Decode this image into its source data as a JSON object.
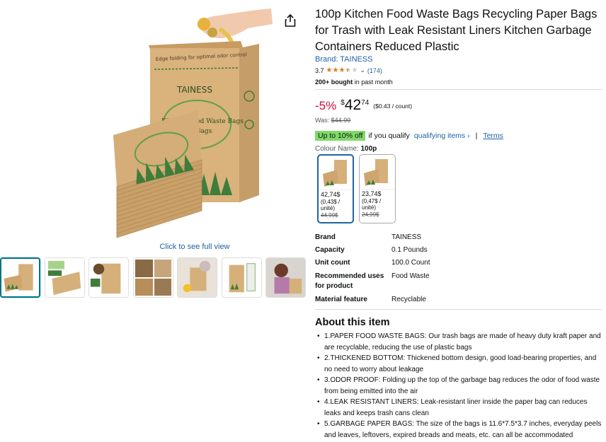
{
  "product": {
    "title": "100p Kitchen Food Waste Bags Recycling Paper Bags for Trash with Leak Resistant Liners Kitchen Garbage Containers Reduced Plastic",
    "brand_link": "Brand: TAINESS",
    "rating_value": "3.7",
    "rating_fraction": 0.74,
    "review_count": "(174)",
    "bought_bold": "200+ bought",
    "bought_rest": " in past month"
  },
  "gallery": {
    "see_full": "Click to see full view",
    "share_icon": "share-icon",
    "thumbnails": [
      {
        "name": "thumb-1",
        "selected": true
      },
      {
        "name": "thumb-2",
        "selected": false
      },
      {
        "name": "thumb-3",
        "selected": false
      },
      {
        "name": "thumb-4",
        "selected": false
      },
      {
        "name": "thumb-5",
        "selected": false
      },
      {
        "name": "thumb-6",
        "selected": false
      },
      {
        "name": "thumb-7",
        "selected": false
      }
    ],
    "box_text": {
      "brand": "TAINESS",
      "line1": "Kitchen Food Waste Bags",
      "line2": "Trash Bags",
      "fold": "Edge folding for optimal odor control"
    }
  },
  "price": {
    "discount": "-5%",
    "currency": "$",
    "whole": "42",
    "fraction": "74",
    "unit_price": "($0.43 / count)",
    "was_label": "Was: ",
    "was_price": "$44.99"
  },
  "promo": {
    "badge": "Up to 10% off",
    "text": " if you qualify",
    "link": "qualifying items ›",
    "sep": "|",
    "terms": "Terms"
  },
  "colour": {
    "label": "Colour Name: ",
    "value": "100p",
    "options": [
      {
        "price": "42,74$",
        "unit": "(0,43$ /",
        "unit2": "unité)",
        "was": "44,99$",
        "selected": true
      },
      {
        "price": "23,74$",
        "unit": "(0,47$ /",
        "unit2": "unité)",
        "was": "24,99$",
        "selected": false
      }
    ]
  },
  "specs": [
    {
      "key": "Brand",
      "value": "TAINESS"
    },
    {
      "key": "Capacity",
      "value": "0.1 Pounds"
    },
    {
      "key": "Unit count",
      "value": "100.0 Count"
    },
    {
      "key": "Recommended uses for product",
      "value": "Food Waste"
    },
    {
      "key": "Material feature",
      "value": "Recyclable"
    }
  ],
  "about": {
    "heading": "About this item",
    "bullets": [
      "1.PAPER FOOD WASTE BAGS: Our trash bags are made of heavy duty kraft paper and are recyclable, reducing the use of plastic bags",
      "2.THICKENED BOTTOM: Thickened bottom design, good load-bearing properties, and no need to worry about leakage",
      "3.ODOR PROOF: Folding up the top of the garbage bag reduces the odor of food waste from being emitted into the air",
      "4.LEAK RESISTANT LINERS: Leak-resistant liner inside the paper bag can reduces leaks and keeps trash cans clean",
      "5.GARBAGE PAPER BAGS: The size of the bags is 11.6*7.5*3.7 inches, everyday peels and leaves, leftovers, expired breads and meats, etc. can all be accommodated"
    ]
  },
  "colors": {
    "link": "#2162a1",
    "discount": "#cc0c39",
    "star": "#de7921",
    "promo_badge": "#7fda69",
    "kraft": "#d6b07a"
  }
}
